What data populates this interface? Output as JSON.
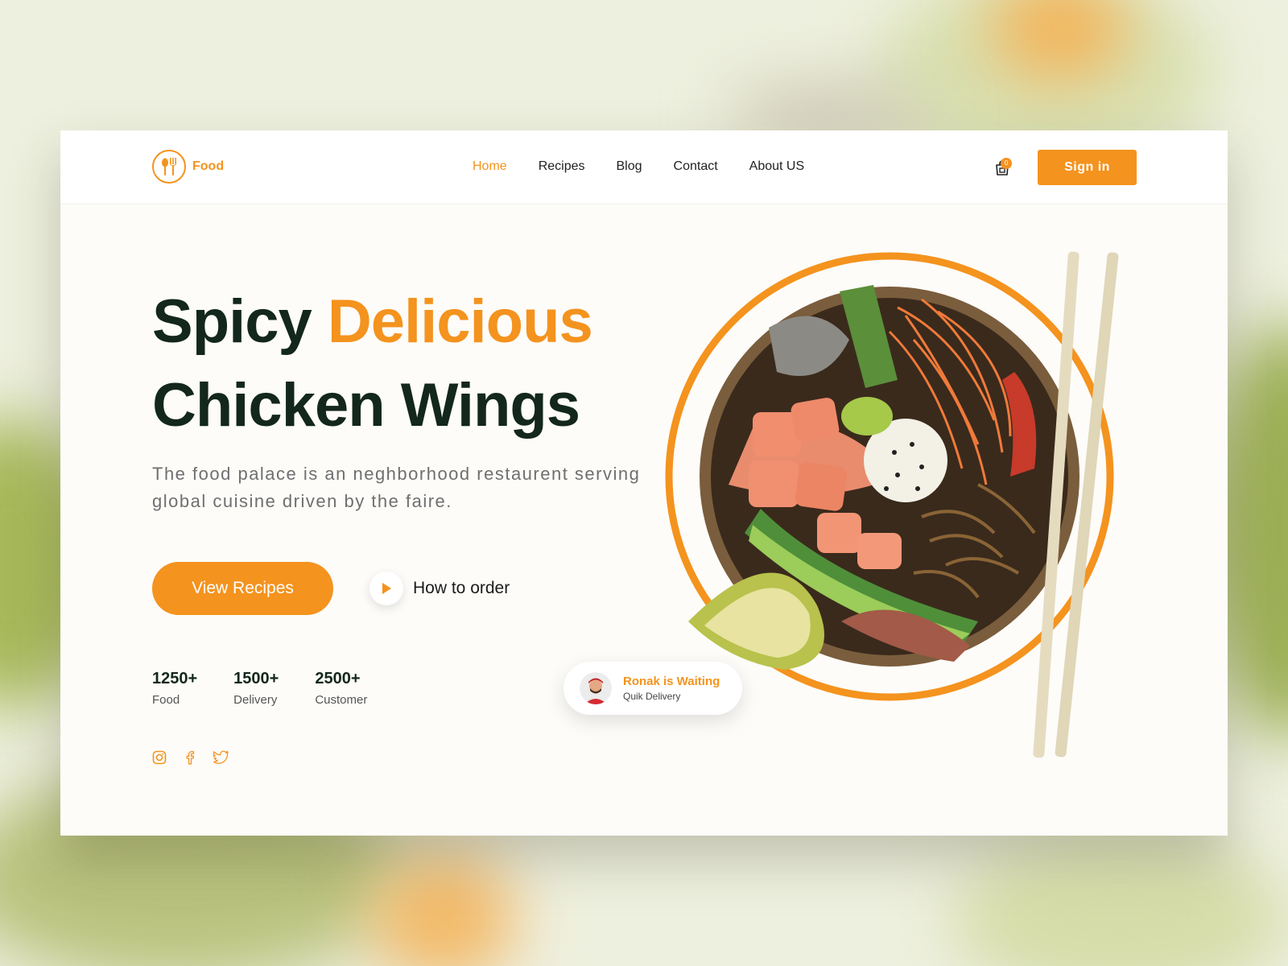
{
  "brand": {
    "name": "Food"
  },
  "nav": {
    "links": [
      "Home",
      "Recipes",
      "Blog",
      "Contact",
      "About US"
    ],
    "active": "Home",
    "cart_count": "0",
    "signin_label": "Sign in"
  },
  "hero": {
    "headline_part1": "Spicy ",
    "headline_accent": "Delicious",
    "headline_line2": "Chicken Wings",
    "description": "The food palace is an neghborhood restaurent serving global cuisine driven by the faire.",
    "primary_button": "View Recipes",
    "secondary_link": "How to order"
  },
  "stats": [
    {
      "value": "1250+",
      "label": "Food"
    },
    {
      "value": "1500+",
      "label": "Delivery"
    },
    {
      "value": "2500+",
      "label": "Customer"
    }
  ],
  "socials": [
    "instagram-icon",
    "facebook-icon",
    "twitter-icon"
  ],
  "delivery_card": {
    "title": "Ronak is Waiting",
    "subtitle": "Quik Delivery"
  },
  "colors": {
    "accent": "#f4931e",
    "heading": "#13271c",
    "background": "#fdfcf9"
  }
}
